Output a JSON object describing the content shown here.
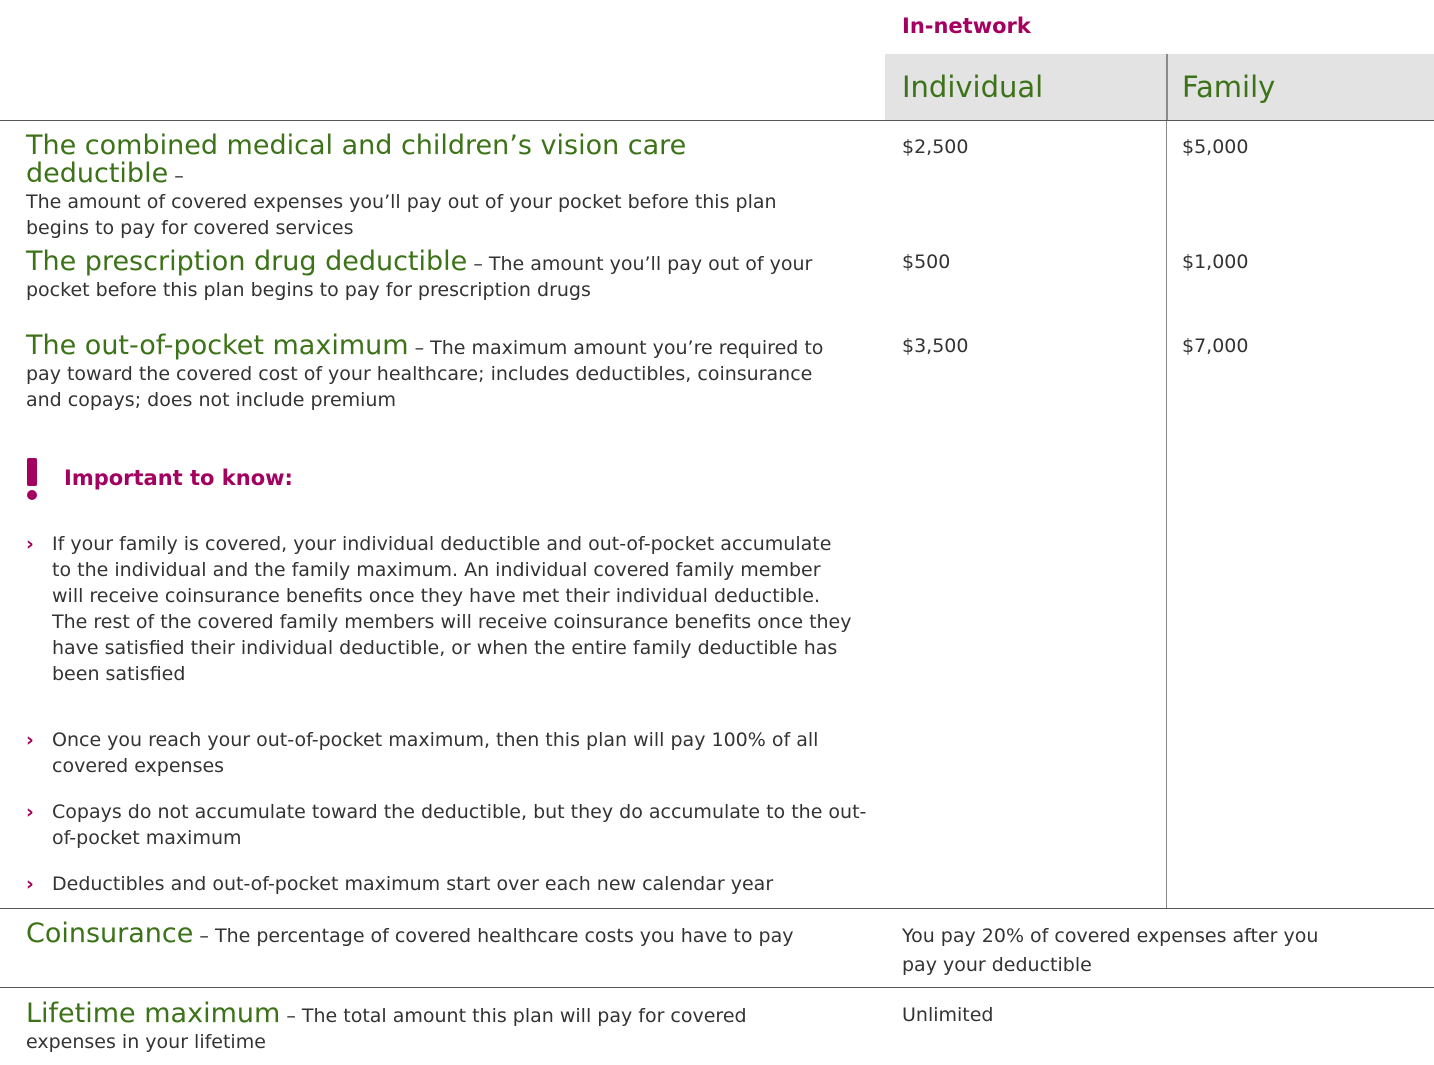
{
  "header": {
    "network": "In-network",
    "individual": "Individual",
    "family": "Family"
  },
  "rows": [
    {
      "term": "The combined medical and children’s vision care deductible",
      "desc_inline": " – ",
      "desc": "The amount of covered expenses you’ll pay out of your pocket before this plan begins to pay for covered services",
      "individual": "$2,500",
      "family": "$5,000"
    },
    {
      "term": "The prescription drug deductible",
      "desc": " – The amount you’ll pay out of your pocket before this plan begins to pay for prescription drugs",
      "individual": "$500",
      "family": "$1,000"
    },
    {
      "term": "The out-of-pocket maximum",
      "desc": " – The maximum amount you’re required to pay toward the covered cost of your healthcare; includes deductibles, coinsurance and copays; does not include premium",
      "individual": "$3,500",
      "family": "$7,000"
    }
  ],
  "important": {
    "title": "Important to know:",
    "bullet_glyph": "›",
    "items": [
      "If your family is covered, your individual deductible and out-of-pocket accumulate to the individual and the family maximum. An individual covered family member will receive coinsurance benefits once they have met their individual deductible. The rest of the covered family members will receive coinsurance benefits once they have satisfied their individual deductible, or when the entire family deductible has been satisfied",
      "Once you reach your out-of-pocket maximum, then this plan will pay 100% of all covered expenses",
      "Copays do not accumulate toward the deductible, but they do accumulate to the out-of-pocket maximum",
      "Deductibles and out-of-pocket maximum start over each new calendar year"
    ]
  },
  "coinsurance": {
    "term": "Coinsurance",
    "desc": " – The percentage of covered healthcare costs you have to pay",
    "value": "You pay 20% of covered expenses after you pay your deductible"
  },
  "lifetime": {
    "term": "Lifetime maximum",
    "desc": " – The total amount this plan will pay for covered expenses in your lifetime",
    "value": "Unlimited"
  },
  "colors": {
    "accent_magenta": "#a3005f",
    "term_green": "#3d7318",
    "header_gray": "#e3e3e3"
  }
}
